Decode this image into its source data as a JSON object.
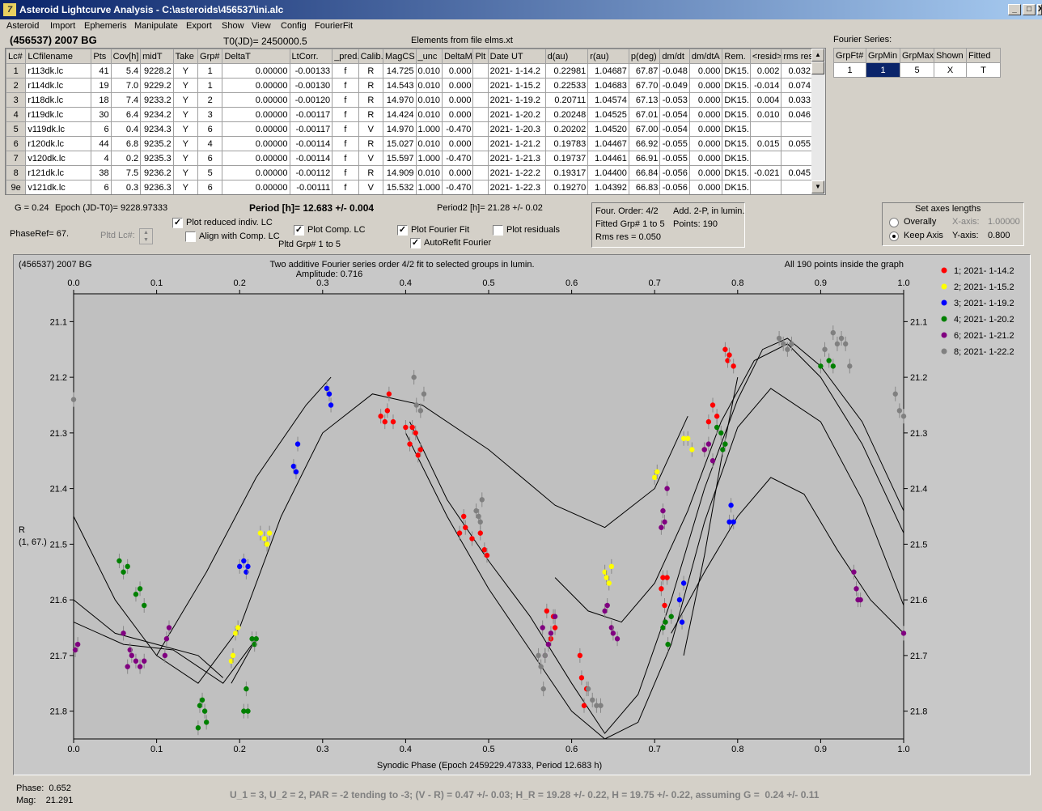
{
  "window": {
    "title": "Asteroid Lightcurve Analysis - C:\\asteroids\\456537\\ini.alc",
    "controls": [
      "_",
      "□",
      "X"
    ]
  },
  "menu": [
    "Asteroid",
    "Import",
    "Ephemeris",
    "Manipulate",
    "Export",
    "Show",
    "View",
    "Config",
    "FourierFit"
  ],
  "header": {
    "object": "(456537) 2007 BG",
    "t0": "T0(JD)= 2450000.5",
    "elements": "Elements from file elms.xt"
  },
  "lc_table": {
    "columns": [
      "Lc#",
      "LCfilename",
      "Pts",
      "Cov[h]",
      "midT",
      "Take",
      "Grp#",
      "DeltaT",
      "LtCorr.",
      "_pred.",
      "Calib.",
      "MagCS",
      "_unc",
      "DeltaM",
      "Plt",
      "Date UT",
      "d(au)",
      "r(au)",
      "p(deg)",
      "dm/dt",
      "dm/dtA",
      "Rem.",
      "<resid>",
      "rms res"
    ],
    "rows": [
      [
        "1",
        "r113dk.lc",
        "41",
        "5.4",
        "9228.2",
        "Y",
        "1",
        "0.00000",
        "-0.00133",
        "f",
        "R",
        "14.725",
        "0.010",
        "0.000",
        "",
        "2021- 1-14.2",
        "0.22981",
        "1.04687",
        "67.87",
        "-0.048",
        "0.000",
        "DK15..",
        "0.002",
        "0.032"
      ],
      [
        "2",
        "r114dk.lc",
        "19",
        "7.0",
        "9229.2",
        "Y",
        "1",
        "0.00000",
        "-0.00130",
        "f",
        "R",
        "14.543",
        "0.010",
        "0.000",
        "",
        "2021- 1-15.2",
        "0.22533",
        "1.04683",
        "67.70",
        "-0.049",
        "0.000",
        "DK15..",
        "-0.014",
        "0.074"
      ],
      [
        "3",
        "r118dk.lc",
        "18",
        "7.4",
        "9233.2",
        "Y",
        "2",
        "0.00000",
        "-0.00120",
        "f",
        "R",
        "14.970",
        "0.010",
        "0.000",
        "",
        "2021- 1-19.2",
        "0.20711",
        "1.04574",
        "67.13",
        "-0.053",
        "0.000",
        "DK15..",
        "0.004",
        "0.033"
      ],
      [
        "4",
        "r119dk.lc",
        "30",
        "6.4",
        "9234.2",
        "Y",
        "3",
        "0.00000",
        "-0.00117",
        "f",
        "R",
        "14.424",
        "0.010",
        "0.000",
        "",
        "2021- 1-20.2",
        "0.20248",
        "1.04525",
        "67.01",
        "-0.054",
        "0.000",
        "DK15..",
        "0.010",
        "0.046"
      ],
      [
        "5",
        "v119dk.lc",
        "6",
        "0.4",
        "9234.3",
        "Y",
        "6",
        "0.00000",
        "-0.00117",
        "f",
        "V",
        "14.970",
        "1.000",
        "-0.470",
        "",
        "2021- 1-20.3",
        "0.20202",
        "1.04520",
        "67.00",
        "-0.054",
        "0.000",
        "DK15..",
        "",
        ""
      ],
      [
        "6",
        "r120dk.lc",
        "44",
        "6.8",
        "9235.2",
        "Y",
        "4",
        "0.00000",
        "-0.00114",
        "f",
        "R",
        "15.027",
        "0.010",
        "0.000",
        "",
        "2021- 1-21.2",
        "0.19783",
        "1.04467",
        "66.92",
        "-0.055",
        "0.000",
        "DK15..",
        "0.015",
        "0.055"
      ],
      [
        "7",
        "v120dk.lc",
        "4",
        "0.2",
        "9235.3",
        "Y",
        "6",
        "0.00000",
        "-0.00114",
        "f",
        "V",
        "15.597",
        "1.000",
        "-0.470",
        "",
        "2021- 1-21.3",
        "0.19737",
        "1.04461",
        "66.91",
        "-0.055",
        "0.000",
        "DK15..",
        "",
        ""
      ],
      [
        "8",
        "r121dk.lc",
        "38",
        "7.5",
        "9236.2",
        "Y",
        "5",
        "0.00000",
        "-0.00112",
        "f",
        "R",
        "14.909",
        "0.010",
        "0.000",
        "",
        "2021- 1-22.2",
        "0.19317",
        "1.04400",
        "66.84",
        "-0.056",
        "0.000",
        "DK15..",
        "-0.021",
        "0.045"
      ],
      [
        "9e",
        "v121dk.lc",
        "6",
        "0.3",
        "9236.3",
        "Y",
        "6",
        "0.00000",
        "-0.00111",
        "f",
        "V",
        "15.532",
        "1.000",
        "-0.470",
        "",
        "2021- 1-22.3",
        "0.19270",
        "1.04392",
        "66.83",
        "-0.056",
        "0.000",
        "DK15..",
        "",
        ""
      ]
    ]
  },
  "fourier_series": {
    "label": "Fourier Series:",
    "columns": [
      "GrpFt#",
      "GrpMin",
      "GrpMax",
      "Shown",
      "Fitted"
    ],
    "row": [
      "1",
      "1",
      "5",
      "X",
      "T"
    ]
  },
  "info": {
    "g": "G = 0.24",
    "epoch": "Epoch (JD-T0)= 9228.97333",
    "period": "Period [h]= 12.683 +/- 0.004",
    "period2": "Period2 [h]= 21.28 +/- 0.02",
    "phaseref": "PhaseRef= 67.",
    "pltd_lc": "Pltd Lc#:",
    "plot_reduced": "Plot reduced indiv. LC",
    "align": "Align with Comp. LC",
    "plot_comp": "Plot Comp. LC",
    "pltd_grp": "Pltd Grp#  1   to   5",
    "plot_fourier": "Plot Fourier Fit",
    "autorefit": "AutoRefit Fourier",
    "plot_resid": "Plot residuals"
  },
  "fit_box": {
    "order": "Four. Order:  4/2",
    "add": "Add. 2-P, in lumin.",
    "fitted": "Fitted Grp# 1 to 5",
    "points": "Points: 190",
    "rms": "Rms res      = 0.050"
  },
  "axes_box": {
    "title": "Set axes lengths",
    "overally": "Overally",
    "keep": "Keep Axis",
    "xaxis_label": "X-axis:",
    "xaxis_val": "1.00000",
    "yaxis_label": "Y-axis:",
    "yaxis_val": "0.800"
  },
  "plot": {
    "top_left": "(456537) 2007 BG",
    "title": "Two additive Fourier series order 4/2 fit to selected groups in lumin.",
    "amplitude": "Amplitude: 0.716",
    "top_right": "All 190 points inside the graph",
    "ylabel1": "R",
    "ylabel2": "(1, 67.)",
    "xlabel": "Synodic Phase (Epoch 2459229.47333, Period 12.683 h)"
  },
  "chart_data": {
    "type": "scatter",
    "xlim": [
      0,
      1
    ],
    "ylim": [
      21.85,
      21.05
    ],
    "x_ticks": [
      "0.0",
      "0.1",
      "0.2",
      "0.3",
      "0.4",
      "0.5",
      "0.6",
      "0.7",
      "0.8",
      "0.9",
      "1.0"
    ],
    "y_ticks": [
      "21.1",
      "21.2",
      "21.3",
      "21.4",
      "21.5",
      "21.6",
      "21.7",
      "21.8"
    ],
    "legend_position": "right",
    "legend": [
      {
        "label": "1; 2021- 1-14.2",
        "color": "#ff0000"
      },
      {
        "label": "2; 2021- 1-15.2",
        "color": "#ffff00"
      },
      {
        "label": "3; 2021- 1-19.2",
        "color": "#0000ff"
      },
      {
        "label": "4; 2021- 1-20.2",
        "color": "#008000"
      },
      {
        "label": "6; 2021- 1-21.2",
        "color": "#800080"
      },
      {
        "label": "8; 2021- 1-22.2",
        "color": "#808080"
      }
    ],
    "series": [
      {
        "color": "#ff0000",
        "points": [
          [
            0.37,
            21.27
          ],
          [
            0.375,
            21.28
          ],
          [
            0.378,
            21.26
          ],
          [
            0.38,
            21.23
          ],
          [
            0.385,
            21.28
          ],
          [
            0.4,
            21.29
          ],
          [
            0.405,
            21.32
          ],
          [
            0.408,
            21.29
          ],
          [
            0.412,
            21.3
          ],
          [
            0.415,
            21.34
          ],
          [
            0.418,
            21.33
          ],
          [
            0.465,
            21.48
          ],
          [
            0.47,
            21.45
          ],
          [
            0.472,
            21.47
          ],
          [
            0.48,
            21.49
          ],
          [
            0.49,
            21.48
          ],
          [
            0.495,
            21.51
          ],
          [
            0.498,
            21.52
          ],
          [
            0.57,
            21.62
          ],
          [
            0.575,
            21.67
          ],
          [
            0.578,
            21.63
          ],
          [
            0.58,
            21.65
          ],
          [
            0.61,
            21.7
          ],
          [
            0.612,
            21.74
          ],
          [
            0.615,
            21.79
          ],
          [
            0.618,
            21.76
          ],
          [
            0.708,
            21.58
          ],
          [
            0.71,
            21.56
          ],
          [
            0.712,
            21.61
          ],
          [
            0.715,
            21.56
          ],
          [
            0.76,
            21.33
          ],
          [
            0.765,
            21.28
          ],
          [
            0.77,
            21.25
          ],
          [
            0.775,
            21.27
          ],
          [
            0.785,
            21.15
          ],
          [
            0.788,
            21.17
          ],
          [
            0.79,
            21.16
          ],
          [
            0.795,
            21.18
          ]
        ]
      },
      {
        "color": "#ffff00",
        "points": [
          [
            0.19,
            21.71
          ],
          [
            0.192,
            21.7
          ],
          [
            0.195,
            21.66
          ],
          [
            0.198,
            21.65
          ],
          [
            0.225,
            21.48
          ],
          [
            0.23,
            21.49
          ],
          [
            0.233,
            21.5
          ],
          [
            0.236,
            21.48
          ],
          [
            0.7,
            21.38
          ],
          [
            0.703,
            21.37
          ],
          [
            0.64,
            21.55
          ],
          [
            0.642,
            21.56
          ],
          [
            0.645,
            21.57
          ],
          [
            0.648,
            21.54
          ],
          [
            0.735,
            21.31
          ],
          [
            0.74,
            21.31
          ],
          [
            0.745,
            21.33
          ]
        ]
      },
      {
        "color": "#0000ff",
        "points": [
          [
            0.2,
            21.54
          ],
          [
            0.205,
            21.53
          ],
          [
            0.208,
            21.55
          ],
          [
            0.21,
            21.54
          ],
          [
            0.265,
            21.36
          ],
          [
            0.268,
            21.37
          ],
          [
            0.27,
            21.32
          ],
          [
            0.305,
            21.22
          ],
          [
            0.308,
            21.23
          ],
          [
            0.31,
            21.25
          ],
          [
            0.73,
            21.6
          ],
          [
            0.733,
            21.64
          ],
          [
            0.735,
            21.57
          ],
          [
            0.79,
            21.46
          ],
          [
            0.792,
            21.43
          ],
          [
            0.795,
            21.46
          ]
        ]
      },
      {
        "color": "#008000",
        "points": [
          [
            0.055,
            21.53
          ],
          [
            0.06,
            21.55
          ],
          [
            0.065,
            21.54
          ],
          [
            0.075,
            21.59
          ],
          [
            0.08,
            21.58
          ],
          [
            0.085,
            21.61
          ],
          [
            0.15,
            21.83
          ],
          [
            0.152,
            21.79
          ],
          [
            0.155,
            21.78
          ],
          [
            0.158,
            21.8
          ],
          [
            0.16,
            21.82
          ],
          [
            0.205,
            21.8
          ],
          [
            0.208,
            21.76
          ],
          [
            0.21,
            21.8
          ],
          [
            0.215,
            21.67
          ],
          [
            0.218,
            21.68
          ],
          [
            0.22,
            21.67
          ],
          [
            0.71,
            21.65
          ],
          [
            0.713,
            21.64
          ],
          [
            0.716,
            21.68
          ],
          [
            0.72,
            21.63
          ],
          [
            0.775,
            21.29
          ],
          [
            0.78,
            21.3
          ],
          [
            0.782,
            21.33
          ],
          [
            0.785,
            21.32
          ],
          [
            0.9,
            21.18
          ],
          [
            0.91,
            21.17
          ],
          [
            0.915,
            21.18
          ]
        ]
      },
      {
        "color": "#800080",
        "points": [
          [
            0.002,
            21.69
          ],
          [
            0.005,
            21.68
          ],
          [
            0.06,
            21.66
          ],
          [
            0.065,
            21.72
          ],
          [
            0.068,
            21.69
          ],
          [
            0.07,
            21.7
          ],
          [
            0.075,
            21.71
          ],
          [
            0.08,
            21.72
          ],
          [
            0.085,
            21.71
          ],
          [
            0.11,
            21.7
          ],
          [
            0.112,
            21.67
          ],
          [
            0.115,
            21.65
          ],
          [
            0.565,
            21.65
          ],
          [
            0.568,
            21.7
          ],
          [
            0.572,
            21.68
          ],
          [
            0.575,
            21.66
          ],
          [
            0.58,
            21.63
          ],
          [
            0.64,
            21.62
          ],
          [
            0.643,
            21.61
          ],
          [
            0.648,
            21.65
          ],
          [
            0.65,
            21.66
          ],
          [
            0.655,
            21.67
          ],
          [
            0.708,
            21.47
          ],
          [
            0.71,
            21.44
          ],
          [
            0.712,
            21.46
          ],
          [
            0.715,
            21.4
          ],
          [
            0.76,
            21.33
          ],
          [
            0.765,
            21.32
          ],
          [
            0.77,
            21.35
          ],
          [
            0.94,
            21.55
          ],
          [
            0.943,
            21.58
          ],
          [
            0.945,
            21.6
          ],
          [
            0.948,
            21.6
          ],
          [
            1.0,
            21.66
          ]
        ]
      },
      {
        "color": "#808080",
        "points": [
          [
            0.0,
            21.24
          ],
          [
            0.41,
            21.2
          ],
          [
            0.413,
            21.25
          ],
          [
            0.418,
            21.26
          ],
          [
            0.422,
            21.23
          ],
          [
            0.485,
            21.44
          ],
          [
            0.488,
            21.45
          ],
          [
            0.49,
            21.46
          ],
          [
            0.492,
            21.42
          ],
          [
            0.56,
            21.7
          ],
          [
            0.563,
            21.72
          ],
          [
            0.566,
            21.76
          ],
          [
            0.568,
            21.7
          ],
          [
            0.62,
            21.76
          ],
          [
            0.625,
            21.78
          ],
          [
            0.63,
            21.79
          ],
          [
            0.635,
            21.79
          ],
          [
            0.85,
            21.13
          ],
          [
            0.855,
            21.14
          ],
          [
            0.86,
            21.15
          ],
          [
            0.865,
            21.14
          ],
          [
            0.905,
            21.15
          ],
          [
            0.915,
            21.12
          ],
          [
            0.92,
            21.14
          ],
          [
            0.925,
            21.13
          ],
          [
            0.93,
            21.14
          ],
          [
            0.935,
            21.18
          ],
          [
            0.99,
            21.23
          ],
          [
            0.995,
            21.26
          ],
          [
            1.0,
            21.27
          ]
        ]
      }
    ]
  }
}
